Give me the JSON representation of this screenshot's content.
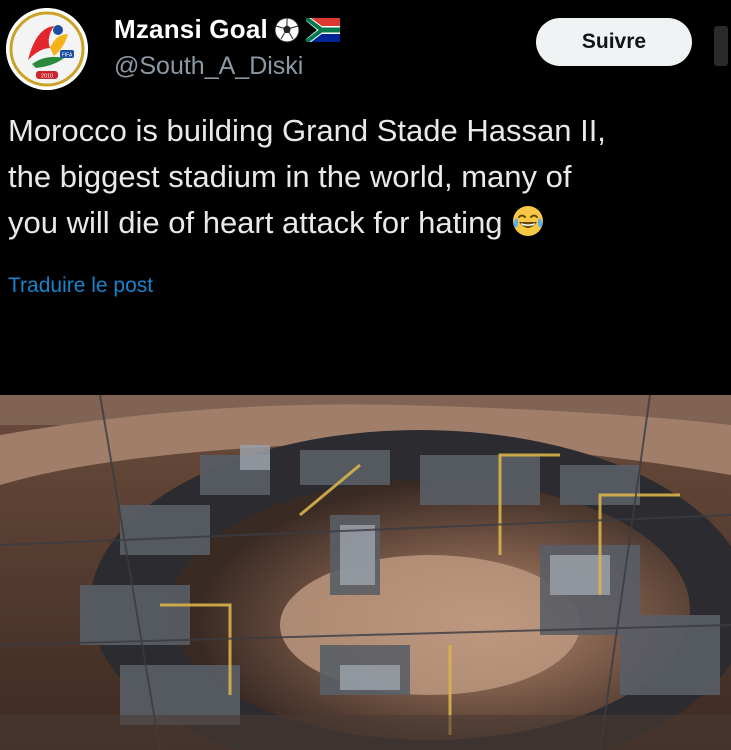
{
  "author": {
    "display_name": "Mzansi Goal",
    "badges": [
      "soccer-ball-icon",
      "south-africa-flag-icon"
    ],
    "handle": "@South_A_Diski",
    "avatar": "fifa-world-cup-2010-logo"
  },
  "follow_button": {
    "label": "Suivre"
  },
  "post": {
    "lines": [
      "Morocco is building Grand Stade Hassan II,",
      "the biggest stadium in the world, many of",
      "you will die of heart attack for hating"
    ],
    "trailing_emoji": "tears-of-joy-emoji",
    "translate_label": "Traduire le post"
  },
  "media": {
    "subject": "aerial-photo-stadium-construction"
  },
  "colors": {
    "background": "#000000",
    "text": "#e7e9ea",
    "handle": "#8b98a5",
    "link": "#1d9bf0",
    "button_bg": "#eff3f4"
  }
}
